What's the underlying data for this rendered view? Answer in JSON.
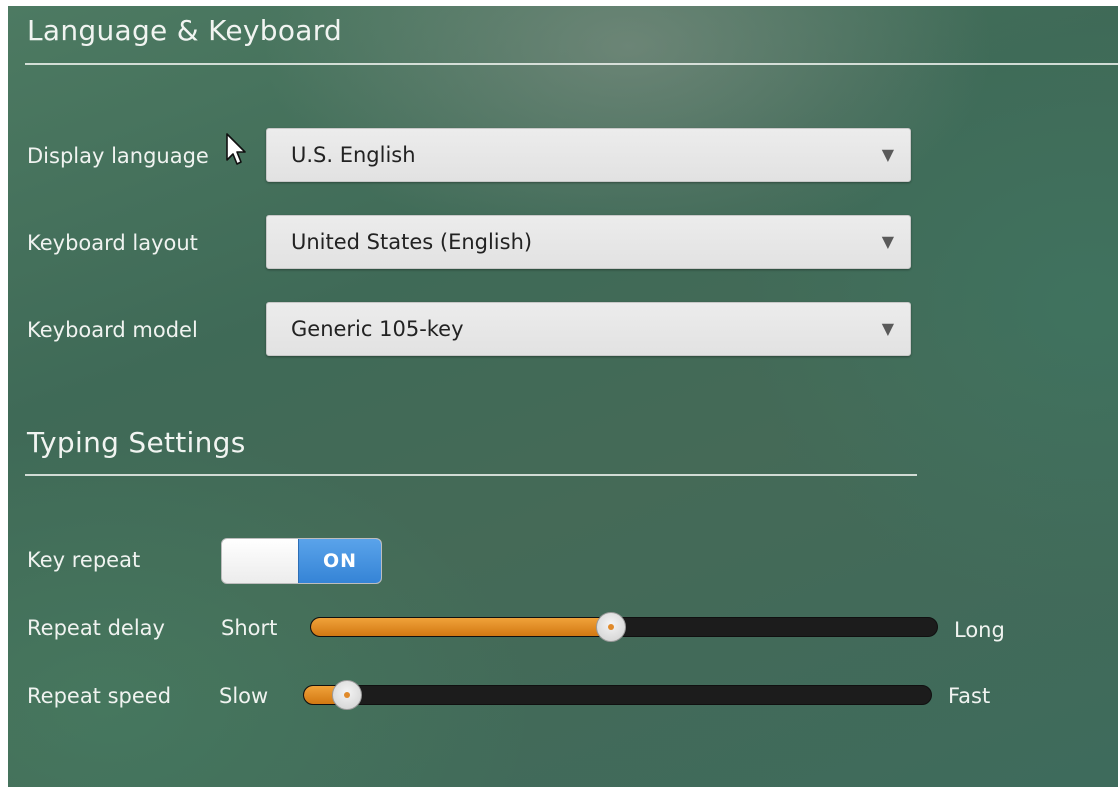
{
  "sections": {
    "language_keyboard_title": "Language & Keyboard",
    "typing_settings_title": "Typing Settings"
  },
  "language": {
    "display_language_label": "Display language",
    "display_language_value": "U.S. English",
    "keyboard_layout_label": "Keyboard layout",
    "keyboard_layout_value": "United States (English)",
    "keyboard_model_label": "Keyboard model",
    "keyboard_model_value": "Generic 105-key"
  },
  "typing": {
    "key_repeat_label": "Key repeat",
    "key_repeat_state": "ON",
    "repeat_delay_label": "Repeat delay",
    "repeat_delay_min": "Short",
    "repeat_delay_max": "Long",
    "repeat_delay_value": 0.48,
    "repeat_speed_label": "Repeat speed",
    "repeat_speed_min": "Slow",
    "repeat_speed_max": "Fast",
    "repeat_speed_value": 0.07
  },
  "icons": {
    "dropdown_caret": "caret-down-icon",
    "cursor": "mouse-pointer-icon"
  },
  "colors": {
    "toggle_on": "#3584d6",
    "slider_fill": "#d27812",
    "slider_track": "#1c1c1c"
  }
}
